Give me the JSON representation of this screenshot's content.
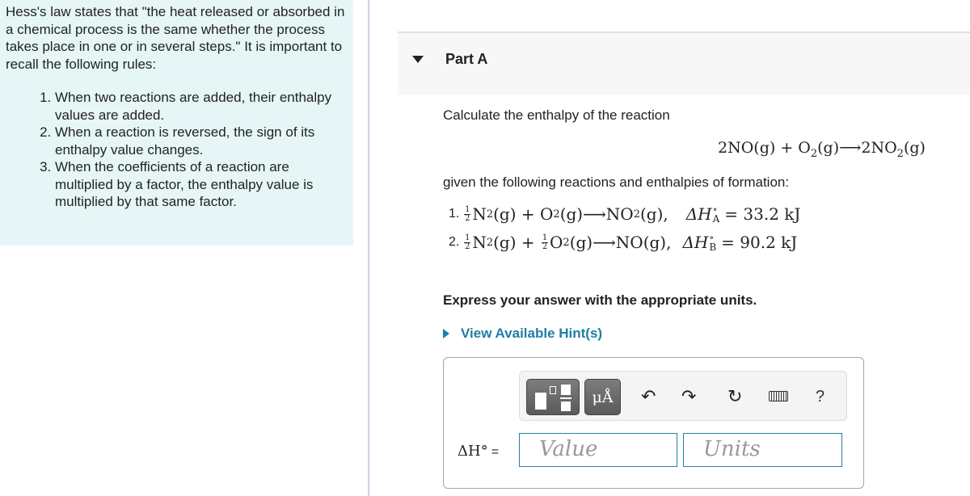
{
  "intro": {
    "paragraph": "Hess's law states that \"the heat released or absorbed in a chemical process is the same whether the process takes place in one or in several steps.\" It is important to recall the following rules:",
    "rules": [
      "When two reactions are added, their enthalpy values are added.",
      "When a reaction is reversed, the sign of its enthalpy value changes.",
      "When the coefficients of a reaction are multiplied by a factor, the enthalpy value is multiplied by that same factor."
    ]
  },
  "part": {
    "title": "Part A",
    "toggle_icon": "triangle-down-icon"
  },
  "question": {
    "prompt": "Calculate the enthalpy of the reaction",
    "target_reaction": {
      "lhs1": "2NO(g) + O",
      "lhs1_sub": "2",
      "lhs2": "(g)⟶2NO",
      "rhs_sub": "2",
      "rhs_end": "(g)"
    },
    "given_label": "given the following reactions and enthalpies of formation:",
    "reactions": [
      {
        "number": "1.",
        "frac1": {
          "num": "1",
          "den": "2"
        },
        "part1": "N",
        "sub1": "2",
        "part2": "(g) + ",
        "frac2": null,
        "part3": "O",
        "sub3": "2",
        "part4": "(g)⟶NO",
        "sub4": "2",
        "part5": "(g),",
        "dh_symbol": "ΔH",
        "dh_sup": "∘",
        "dh_sub": "A",
        "dh_value": "= 33.2 kJ"
      },
      {
        "number": "2.",
        "frac1": {
          "num": "1",
          "den": "2"
        },
        "part1": "N",
        "sub1": "2",
        "part2": "(g) + ",
        "frac2": {
          "num": "1",
          "den": "2"
        },
        "part3": "O",
        "sub3": "2",
        "part4": "(g)⟶NO",
        "sub4": "",
        "part5": "(g),",
        "dh_symbol": "ΔH",
        "dh_sup": "∘",
        "dh_sub": "B",
        "dh_value": "= 90.2 kJ"
      }
    ],
    "instruction": "Express your answer with the appropriate units.",
    "hint_link": "View Available Hint(s)"
  },
  "answer": {
    "toolbar": {
      "templates_label": "",
      "units_label": "μÅ",
      "undo": "↶",
      "redo": "↷",
      "reset": "↻",
      "help": "?"
    },
    "label_symbol": "ΔH°",
    "label_eq": "=",
    "value_placeholder": "Value",
    "units_placeholder": "Units"
  },
  "colors": {
    "intro_bg": "#e6f6f7",
    "link": "#1d7fa3",
    "input_border": "#2a7fa6",
    "toolbar_button": "#6a6a6a"
  }
}
